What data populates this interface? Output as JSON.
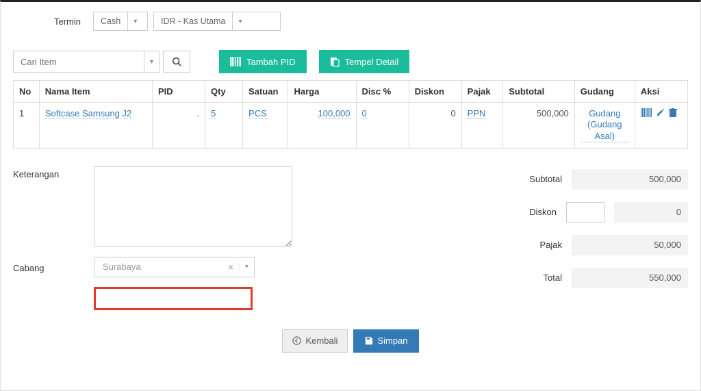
{
  "termin": {
    "label": "Termin",
    "term_value": "Cash",
    "account_value": "IDR - Kas Utama"
  },
  "item_search": {
    "placeholder": "Cari Item"
  },
  "buttons": {
    "tambah_pid": "Tambah PID",
    "tempel_detail": "Tempel Detail",
    "kembali": "Kembali",
    "simpan": "Simpan"
  },
  "columns": {
    "no": "No",
    "nama_item": "Nama Item",
    "pid": "PID",
    "qty": "Qty",
    "satuan": "Satuan",
    "harga": "Harga",
    "disc_pct": "Disc %",
    "diskon": "Diskon",
    "pajak": "Pajak",
    "subtotal": "Subtotal",
    "gudang": "Gudang",
    "aksi": "Aksi"
  },
  "rows": [
    {
      "no": "1",
      "nama_item": "Softcase Samsung J2",
      "pid": ".",
      "qty": "5",
      "satuan": "PCS",
      "harga": "100,000",
      "disc_pct": "0",
      "diskon": "0",
      "pajak": "PPN",
      "subtotal": "500,000",
      "gudang": "Gudang (Gudang Asal)"
    }
  ],
  "keterangan": {
    "label": "Keterangan",
    "value": ""
  },
  "cabang": {
    "label": "Cabang",
    "value": "Surabaya"
  },
  "summary": {
    "subtotal_label": "Subtotal",
    "subtotal": "500,000",
    "diskon_label": "Diskon",
    "diskon_input": "",
    "diskon": "0",
    "pajak_label": "Pajak",
    "pajak": "50,000",
    "total_label": "Total",
    "total": "550,000"
  }
}
